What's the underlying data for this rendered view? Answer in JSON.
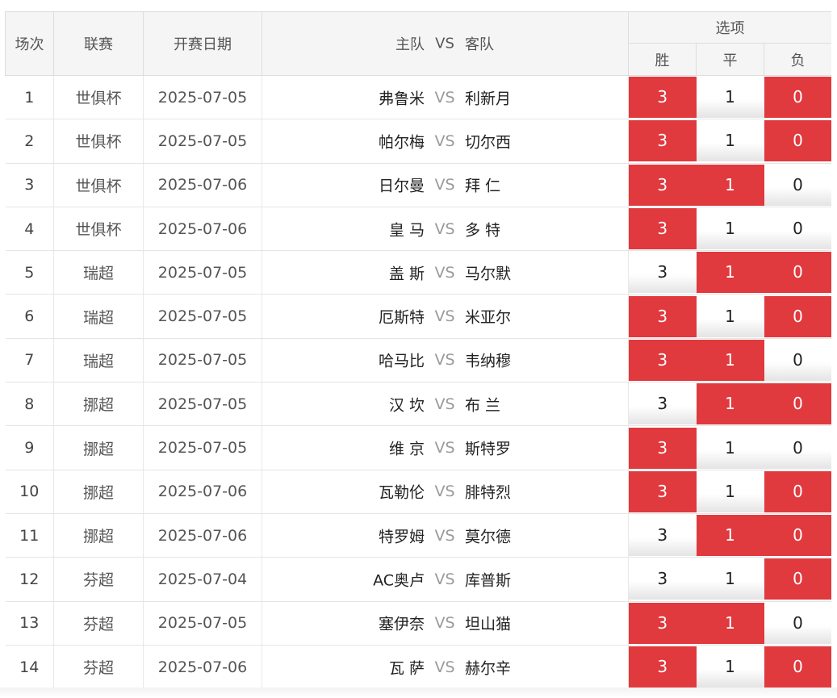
{
  "header": {
    "col_index": "场次",
    "col_league": "联赛",
    "col_date": "开赛日期",
    "col_home": "主队",
    "col_vs": "VS",
    "col_away": "客队",
    "col_options": "选项",
    "opt_win": "胜",
    "opt_draw": "平",
    "opt_lose": "负"
  },
  "colors": {
    "selected": "#e0393e",
    "header_bg": "#f5f5f5"
  },
  "matches": [
    {
      "idx": "1",
      "league": "世俱杯",
      "date": "2025-07-05",
      "home": "弗鲁米",
      "vs": "VS",
      "away": "利新月",
      "win": "3",
      "draw": "1",
      "lose": "0",
      "selected": [
        "win",
        "lose"
      ]
    },
    {
      "idx": "2",
      "league": "世俱杯",
      "date": "2025-07-05",
      "home": "帕尔梅",
      "vs": "VS",
      "away": "切尔西",
      "win": "3",
      "draw": "1",
      "lose": "0",
      "selected": [
        "win",
        "lose"
      ]
    },
    {
      "idx": "3",
      "league": "世俱杯",
      "date": "2025-07-06",
      "home": "日尔曼",
      "vs": "VS",
      "away": "拜 仁",
      "win": "3",
      "draw": "1",
      "lose": "0",
      "selected": [
        "win",
        "draw"
      ]
    },
    {
      "idx": "4",
      "league": "世俱杯",
      "date": "2025-07-06",
      "home": "皇 马",
      "vs": "VS",
      "away": "多 特",
      "win": "3",
      "draw": "1",
      "lose": "0",
      "selected": [
        "win"
      ]
    },
    {
      "idx": "5",
      "league": "瑞超",
      "date": "2025-07-05",
      "home": "盖 斯",
      "vs": "VS",
      "away": "马尔默",
      "win": "3",
      "draw": "1",
      "lose": "0",
      "selected": [
        "draw",
        "lose"
      ]
    },
    {
      "idx": "6",
      "league": "瑞超",
      "date": "2025-07-05",
      "home": "厄斯特",
      "vs": "VS",
      "away": "米亚尔",
      "win": "3",
      "draw": "1",
      "lose": "0",
      "selected": [
        "win",
        "lose"
      ]
    },
    {
      "idx": "7",
      "league": "瑞超",
      "date": "2025-07-05",
      "home": "哈马比",
      "vs": "VS",
      "away": "韦纳穆",
      "win": "3",
      "draw": "1",
      "lose": "0",
      "selected": [
        "win",
        "draw"
      ]
    },
    {
      "idx": "8",
      "league": "挪超",
      "date": "2025-07-05",
      "home": "汉 坎",
      "vs": "VS",
      "away": "布 兰",
      "win": "3",
      "draw": "1",
      "lose": "0",
      "selected": [
        "draw",
        "lose"
      ]
    },
    {
      "idx": "9",
      "league": "挪超",
      "date": "2025-07-05",
      "home": "维 京",
      "vs": "VS",
      "away": "斯特罗",
      "win": "3",
      "draw": "1",
      "lose": "0",
      "selected": [
        "win"
      ]
    },
    {
      "idx": "10",
      "league": "挪超",
      "date": "2025-07-06",
      "home": "瓦勒伦",
      "vs": "VS",
      "away": "腓特烈",
      "win": "3",
      "draw": "1",
      "lose": "0",
      "selected": [
        "win",
        "lose"
      ]
    },
    {
      "idx": "11",
      "league": "挪超",
      "date": "2025-07-06",
      "home": "特罗姆",
      "vs": "VS",
      "away": "莫尔德",
      "win": "3",
      "draw": "1",
      "lose": "0",
      "selected": [
        "draw",
        "lose"
      ]
    },
    {
      "idx": "12",
      "league": "芬超",
      "date": "2025-07-04",
      "home": "AC奥卢",
      "vs": "VS",
      "away": "库普斯",
      "win": "3",
      "draw": "1",
      "lose": "0",
      "selected": [
        "lose"
      ]
    },
    {
      "idx": "13",
      "league": "芬超",
      "date": "2025-07-05",
      "home": "塞伊奈",
      "vs": "VS",
      "away": "坦山猫",
      "win": "3",
      "draw": "1",
      "lose": "0",
      "selected": [
        "win",
        "draw"
      ]
    },
    {
      "idx": "14",
      "league": "芬超",
      "date": "2025-07-06",
      "home": "瓦 萨",
      "vs": "VS",
      "away": "赫尔辛",
      "win": "3",
      "draw": "1",
      "lose": "0",
      "selected": [
        "win",
        "lose"
      ]
    }
  ]
}
